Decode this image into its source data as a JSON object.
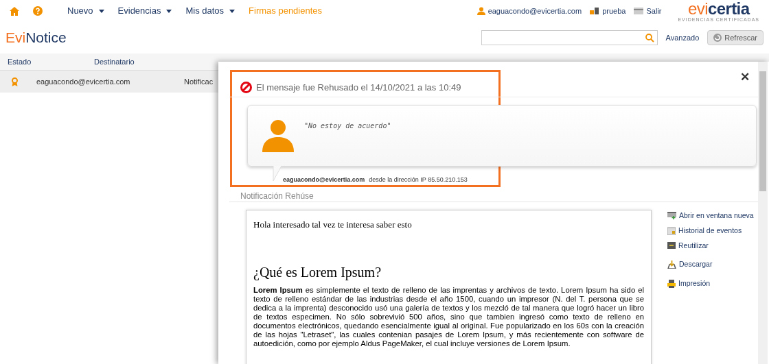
{
  "nav": {
    "menus": [
      {
        "label": "Nuevo",
        "dropdown": true
      },
      {
        "label": "Evidencias",
        "dropdown": true
      },
      {
        "label": "Mis datos",
        "dropdown": true
      },
      {
        "label": "Firmas pendientes",
        "dropdown": false
      }
    ],
    "user": "eaguacondo@evicertia.com",
    "account": "prueba",
    "logout": "Salir",
    "logo": {
      "first": "evi",
      "second": "certia",
      "tagline": "EVIDENCIAS CERTIFICADAS"
    }
  },
  "app_title": {
    "first": "Evi",
    "second": "Notice"
  },
  "search": {
    "advanced": "Avanzado",
    "refresh": "Refrescar"
  },
  "table": {
    "columns": [
      "Estado",
      "Destinatario"
    ],
    "rows": [
      {
        "recipient": "eaguacondo@evicertia.com",
        "subject": "Notificac",
        "selected": true
      }
    ]
  },
  "modal": {
    "close": "✕",
    "status": "El mensaje fue Rehusado el 14/10/2021 a las 10:49",
    "comment": "\"No estoy de acuerdo\"",
    "author": "eaguacondo@evicertia.com",
    "origin": "desde la dirección IP 85.50.210.153",
    "section": "Notificación Rehúse",
    "document": {
      "greeting": "Hola interesado tal vez te interesa saber esto",
      "heading": "¿Qué es Lorem Ipsum?",
      "body": "**Lorem Ipsum** es simplemente el texto de relleno de las imprentas y archivos de texto. Lorem Ipsum ha sido el texto de relleno estándar de las industrias desde el año 1500, cuando un impresor (N. del T. persona que se dedica a la imprenta) desconocido usó una galería de textos y los mezcló de tal manera que logró hacer un libro de textos especimen. No sólo sobrevivió 500 años, sino que tambien ingresó como texto de relleno en documentos electrónicos, quedando esencialmente igual al original. Fue popularizado en los 60s con la creación de las hojas \"Letraset\", las cuales contenian pasajes de Lorem Ipsum, y más recientemente con software de autoedición, como por ejemplo Aldus PageMaker, el cual incluye versiones de Lorem Ipsum."
    },
    "actions": [
      {
        "kind": "window",
        "label": "Abrir en ventana nueva"
      },
      {
        "kind": "calendar",
        "label": "Historial de eventos"
      },
      {
        "kind": "reuse",
        "label": "Reutilizar"
      },
      {
        "kind": "download",
        "label": "Descargar"
      },
      {
        "kind": "print",
        "label": "Impresión"
      }
    ]
  }
}
